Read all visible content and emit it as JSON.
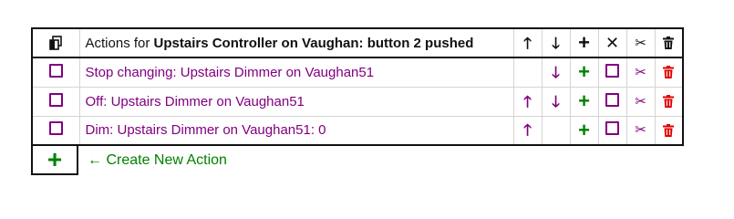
{
  "header": {
    "title_prefix": "Actions for ",
    "title_subject": "Upstairs Controller on Vaughan: button 2 pushed",
    "icons": [
      "copy-icon",
      "arrow-up-icon",
      "arrow-down-icon",
      "plus-icon",
      "x-icon",
      "scissors-icon",
      "trash-icon"
    ]
  },
  "glyphs": {
    "up": "🡑",
    "down": "🡓",
    "plus": "+",
    "x": "✕",
    "scissors": "✂",
    "add_arrow": "←"
  },
  "rows": [
    {
      "text": "Stop changing: Upstairs Dimmer on Vaughan51",
      "has_up": false,
      "has_down": true
    },
    {
      "text": "Off: Upstairs Dimmer on Vaughan51",
      "has_up": true,
      "has_down": true
    },
    {
      "text": "Dim: Upstairs Dimmer on Vaughan51: 0",
      "has_up": true,
      "has_down": false
    }
  ],
  "create_action": {
    "label": "← Create New Action"
  },
  "colors": {
    "row_text": "#800080",
    "add": "#008000",
    "delete": "#e00000"
  }
}
